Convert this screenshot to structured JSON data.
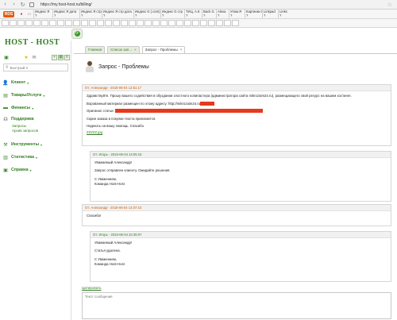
{
  "browser": {
    "url": "https://my.host-host.ru/billing/",
    "seo_bar": {
      "logo": "RDS",
      "cells": [
        {
          "label": "Индекс Я",
          "value": "?"
        },
        {
          "label": "Индекс Я дата",
          "value": "?"
        },
        {
          "label": "Индекс Я стр",
          "value": "?"
        },
        {
          "label": "Индекс Я стр дата",
          "value": "?"
        },
        {
          "label": "Индекс G (.com)",
          "value": "?"
        },
        {
          "label": "Индекс G стр",
          "value": "?"
        },
        {
          "label": "ТИЦ, А.К.",
          "value": "?"
        },
        {
          "label": "Back G",
          "value": "?"
        },
        {
          "label": "Alexa",
          "value": "?"
        },
        {
          "label": "Упом.Я",
          "value": "?"
        },
        {
          "label": "Картинки Я",
          "value": "?"
        },
        {
          "label": "Linkpad",
          "value": "?"
        },
        {
          "label": "Links",
          "value": "?"
        }
      ]
    }
  },
  "sidebar": {
    "logo": "HOST - HOST",
    "search_placeholder": "Быстрый п",
    "items": [
      {
        "label": "Клиент",
        "icon": "user-icon"
      },
      {
        "label": "Товары/Услуги",
        "icon": "box-icon"
      },
      {
        "label": "Финансы",
        "icon": "finance-icon"
      },
      {
        "label": "Поддержка",
        "icon": "headset-icon"
      },
      {
        "label": "Инструменты",
        "icon": "tools-icon"
      },
      {
        "label": "Статистика",
        "icon": "stats-icon"
      },
      {
        "label": "Справка",
        "icon": "help-icon"
      }
    ],
    "support_sub": [
      "Запросы",
      "Архив запросов"
    ]
  },
  "tabs": [
    {
      "label": "Главная"
    },
    {
      "label": "Список зап..."
    },
    {
      "label": "Запрос - Проблемы"
    }
  ],
  "ticket": {
    "title": "Запрос - Проблемы",
    "messages": [
      {
        "head": "От: Александр - 2016-06-04 12:51:17",
        "lines": [
          "Здравствуйте. Прошу вашего содействия в обуздании злостного копипастера (администратора сайта mikrozaim24.ru), размещающего свой ресурс на вашем хостинге.",
          "Ворованный материал размещен по этому адресу: http://mikrozaim24.ru",
          "Оригинал статьи:",
          "Скрин заказа и покупки текста прилагается.",
          "Надеюсь на вашу помощь. Спасибо",
          "ZZZZZ.jpg"
        ]
      },
      {
        "head": "От: Игорь - 2016-06-04 14:05:15",
        "lines": [
          "Уважаемый Александр!",
          "Запрос отправлен клиенту. Ожидайте решения.",
          "С Уважением,",
          "Команда Host-Host"
        ]
      },
      {
        "head": "От: Александр - 2016-06-04 14:07:43",
        "lines": [
          "Спасибо!"
        ]
      },
      {
        "head": "От: Игорь - 2016-06-04 22:35:07",
        "lines": [
          "Уважаемый Александр!",
          "Статья удалена.",
          "С Уважением,",
          "Команда Host-Host"
        ]
      }
    ],
    "edit_link": "Цитировать",
    "reply_placeholder": "Текст сообщения"
  },
  "colors": {
    "accent": "#2e7d1f",
    "client_head": "#d35a00",
    "redaction": "#e53a1d"
  }
}
